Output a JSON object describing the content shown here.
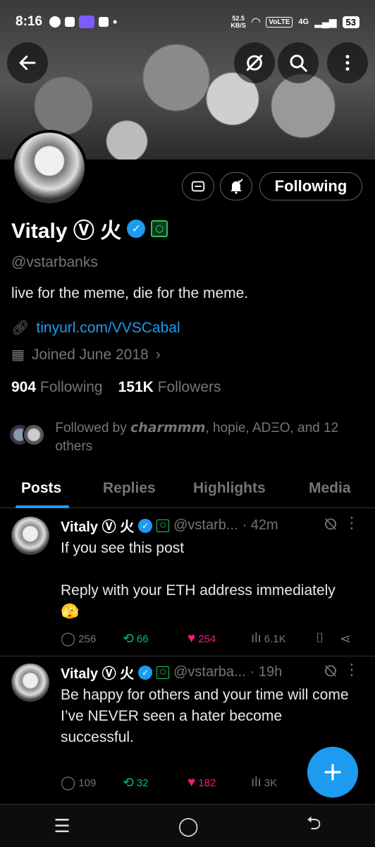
{
  "status_bar": {
    "time": "8:16",
    "speed": "52.5",
    "speed_unit": "KB/S",
    "network": "VoLTE",
    "signal": "4G",
    "battery": "53"
  },
  "profile": {
    "name": "Vitaly",
    "name_suffix": "Ⓥ 火",
    "handle": "@vstarbanks",
    "bio": "live for the meme, die for the meme.",
    "link": "tinyurl.com/VVSCabal",
    "joined": "Joined June 2018",
    "following_count": "904",
    "following_label": "Following",
    "followers_count": "151K",
    "followers_label": "Followers",
    "followed_by_prefix": "Followed by ",
    "followed_by_first": "𝙘𝙝𝙖𝙧𝙢𝙢𝙢",
    "followed_by_rest": ", hopie, ADΞO, and 12 others",
    "follow_button": "Following"
  },
  "tabs": [
    "Posts",
    "Replies",
    "Highlights",
    "Media"
  ],
  "posts": [
    {
      "name": "Vitaly",
      "name_suffix": "Ⓥ 火",
      "handle": "@vstarb...",
      "time": "· 42m",
      "text": "If you see this post\n\nReply with your ETH address immediately 🫣",
      "replies": "256",
      "reposts": "66",
      "likes": "254",
      "views": "6.1K"
    },
    {
      "name": "Vitaly",
      "name_suffix": "Ⓥ 火",
      "handle": "@vstarba...",
      "time": "· 19h",
      "text": "Be happy for others and your time will come\nI’ve NEVER seen a hater become successful.",
      "replies": "109",
      "reposts": "32",
      "likes": "182",
      "views": "3K"
    }
  ],
  "icons": {
    "back": "arrow-left-icon",
    "grok": "grok-icon",
    "search": "search-icon",
    "more": "more-vertical-icon",
    "message": "envelope-icon",
    "notifications": "bell-check-icon",
    "compose": "plus-icon"
  },
  "colors": {
    "accent": "#1d9bf0",
    "repost": "#00ba7c",
    "like": "#f91880",
    "muted": "#71767b"
  }
}
